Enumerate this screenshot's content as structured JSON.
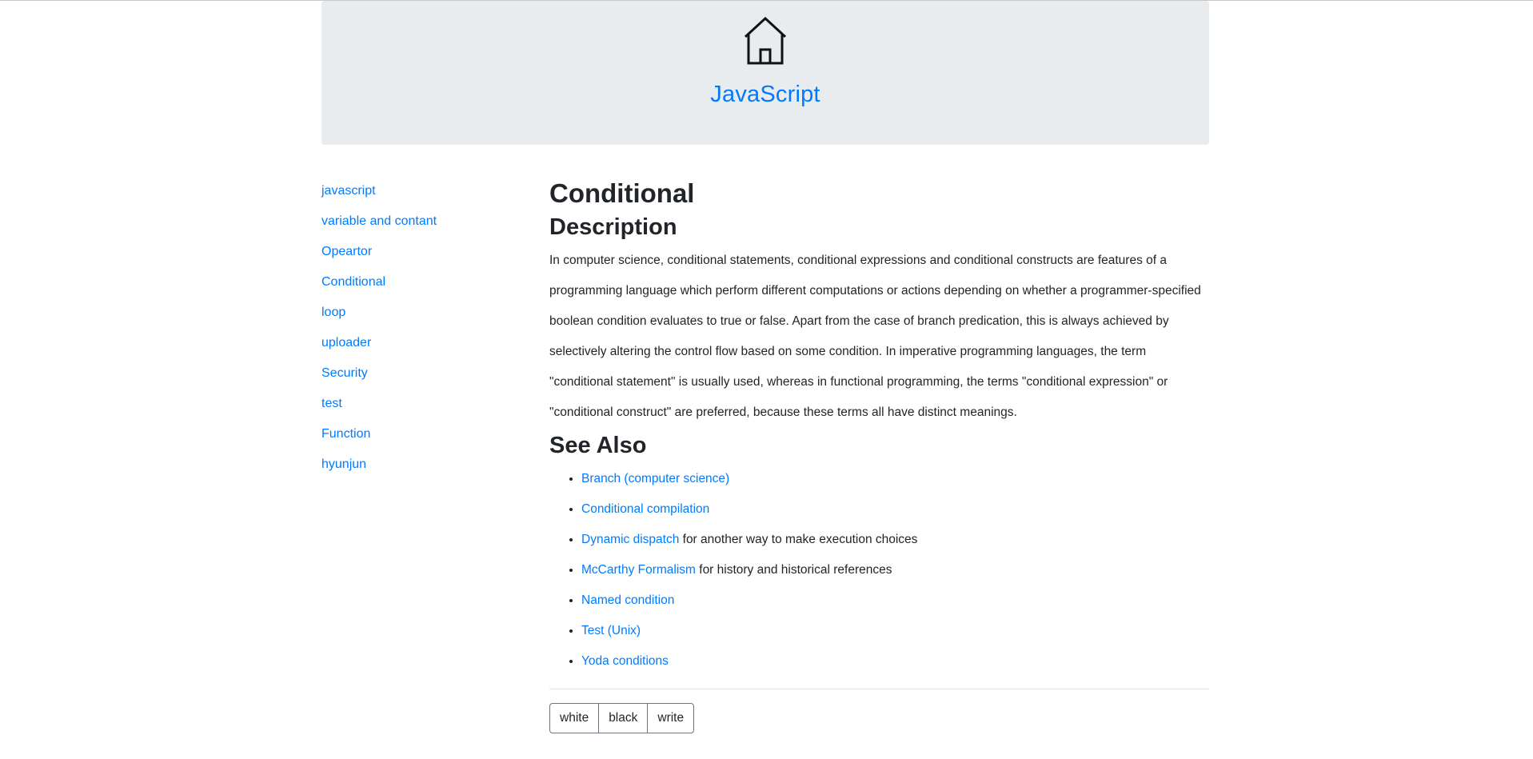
{
  "header": {
    "brand": "JavaScript",
    "icon": "home-icon"
  },
  "sidebar": {
    "items": [
      {
        "label": "javascript"
      },
      {
        "label": "variable and contant"
      },
      {
        "label": "Opeartor"
      },
      {
        "label": "Conditional"
      },
      {
        "label": "loop"
      },
      {
        "label": "uploader"
      },
      {
        "label": "Security"
      },
      {
        "label": "test"
      },
      {
        "label": "Function"
      },
      {
        "label": "hyunjun"
      }
    ]
  },
  "main": {
    "title": "Conditional",
    "description_heading": "Description",
    "description": "In computer science, conditional statements, conditional expressions and conditional constructs are features of a programming language which perform different computations or actions depending on whether a programmer-specified boolean condition evaluates to true or false. Apart from the case of branch predication, this is always achieved by selectively altering the control flow based on some condition. In imperative programming languages, the term \"conditional statement\" is usually used, whereas in functional programming, the terms \"conditional expression\" or \"conditional construct\" are preferred, because these terms all have distinct meanings.",
    "see_also_heading": "See Also",
    "see_also": [
      {
        "link": "Branch (computer science)",
        "suffix": ""
      },
      {
        "link": "Conditional compilation",
        "suffix": ""
      },
      {
        "link": "Dynamic dispatch",
        "suffix": " for another way to make execution choices"
      },
      {
        "link": "McCarthy Formalism",
        "suffix": " for history and historical references"
      },
      {
        "link": "Named condition",
        "suffix": ""
      },
      {
        "link": "Test (Unix)",
        "suffix": ""
      },
      {
        "link": "Yoda conditions",
        "suffix": ""
      }
    ]
  },
  "buttons": {
    "white": "white",
    "black": "black",
    "write": "write"
  },
  "colors": {
    "link": "#007bff",
    "jumbotron_bg": "#e9ecef",
    "text": "#212529"
  }
}
